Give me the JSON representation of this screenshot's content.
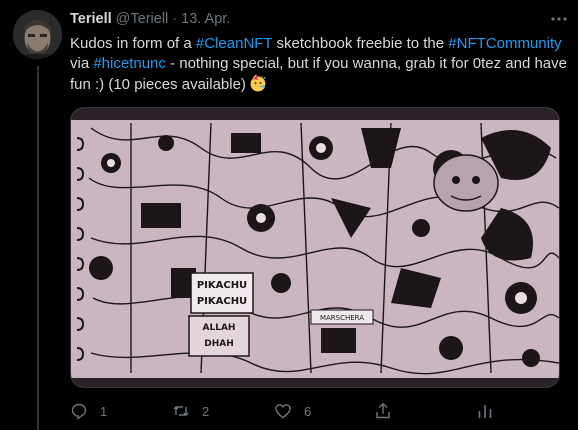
{
  "tweet": {
    "author_name": "Teriell",
    "author_handle": "@Teriell",
    "separator": "·",
    "date": "13. Apr.",
    "text": {
      "line1_pre": "Kudos in form of a ",
      "hashtag1": "#CleanNFT",
      "line1_mid": " sketchbook freebie to the ",
      "hashtag2": "#NFTCommunity",
      "line2_pre": "via ",
      "hashtag3": "#hicetnunc",
      "line2_post": " - nothing special, but if you wanna, grab it for 0tez and have",
      "line3": "fun :) (10 pieces available)"
    },
    "emoji": "party-face-emoji",
    "media_label": "sketchbook-drawing",
    "image_text": {
      "pikachu1": "PIKACHU",
      "pikachu2": "PIKACHU",
      "allah1": "ALLAH",
      "allah2": "DHAH",
      "marschera": "MARSCHERA"
    }
  },
  "actions": {
    "reply_count": "1",
    "retweet_count": "2",
    "like_count": "6",
    "share_label": "",
    "stats_label": ""
  },
  "icons": {
    "more": "more-icon",
    "reply": "reply-icon",
    "retweet": "retweet-icon",
    "like": "heart-icon",
    "share": "share-icon",
    "stats": "analytics-icon"
  },
  "colors": {
    "background": "#000000",
    "text": "#d9d9d9",
    "muted": "#6e767d",
    "link": "#1d9bf0",
    "divider": "#2f3336"
  }
}
